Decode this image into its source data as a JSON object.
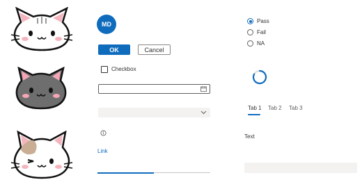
{
  "avatar": {
    "initials": "MD"
  },
  "buttons": {
    "ok_label": "OK",
    "cancel_label": "Cancel"
  },
  "checkbox": {
    "label": "Checkbox",
    "checked": false
  },
  "datepicker": {
    "value": "",
    "icon": "calendar-icon"
  },
  "dropdown": {
    "selected": "",
    "icon": "chevron-down-icon"
  },
  "info": {
    "icon": "info-icon"
  },
  "link": {
    "label": "Link"
  },
  "progress": {
    "value": 0.5
  },
  "radio_group": {
    "options": [
      {
        "label": "Pass",
        "checked": true
      },
      {
        "label": "Fail",
        "checked": false
      },
      {
        "label": "NA",
        "checked": false
      }
    ]
  },
  "spinner": {
    "icon": "loading-spinner-icon"
  },
  "tabs": [
    {
      "label": "Tab 1",
      "active": true
    },
    {
      "label": "Tab 2",
      "active": false
    },
    {
      "label": "Tab 3",
      "active": false
    }
  ],
  "text": {
    "label": "Text"
  },
  "text_input": {
    "value": ""
  },
  "colors": {
    "accent": "#0f6cbd",
    "field_bg": "#f3f2f1",
    "border": "#8a8886"
  },
  "images": [
    "white-cat-icon",
    "gray-cat-icon",
    "calico-cat-icon"
  ]
}
